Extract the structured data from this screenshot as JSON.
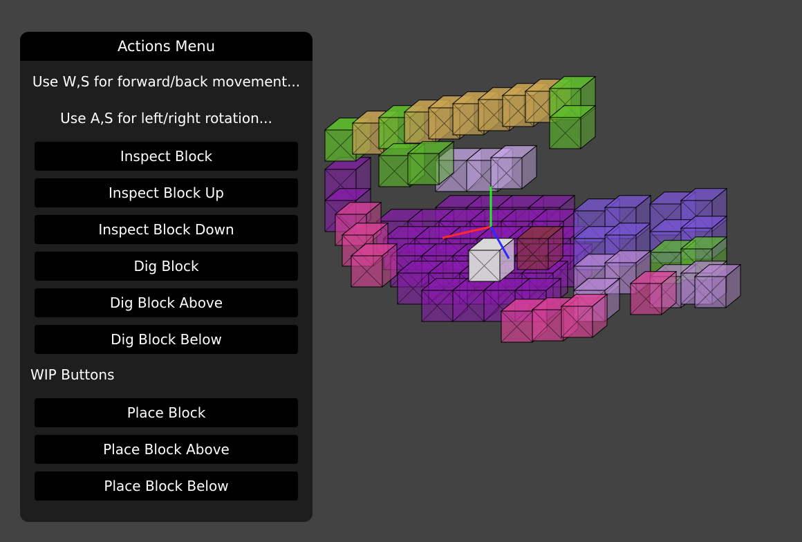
{
  "menu": {
    "title": "Actions Menu",
    "hints": [
      "Use W,S for forward/back movement...",
      "Use A,S for left/right rotation..."
    ],
    "actions": [
      "Inspect Block",
      "Inspect Block Up",
      "Inspect Block Down",
      "Dig Block",
      "Dig Block Above",
      "Dig Block Below"
    ],
    "wip_label": "WIP Buttons",
    "wip_actions": [
      "Place Block",
      "Place Block Above",
      "Place Block Below"
    ]
  },
  "scene": {
    "background": "#434343",
    "axis_colors": {
      "x": "#ff2a2a",
      "y": "#22ee22",
      "z": "#2a2aff"
    },
    "block_colors": {
      "green": "#5fbf2a",
      "tan": "#c8a452",
      "lavender": "#c7a8e8",
      "purple": "#8a1ab0",
      "pink": "#e0429a",
      "violet": "#7a55d8",
      "lightpink": "#b98ad8",
      "brown": "#8a3a2a",
      "robot": "#d8d8d8"
    }
  }
}
